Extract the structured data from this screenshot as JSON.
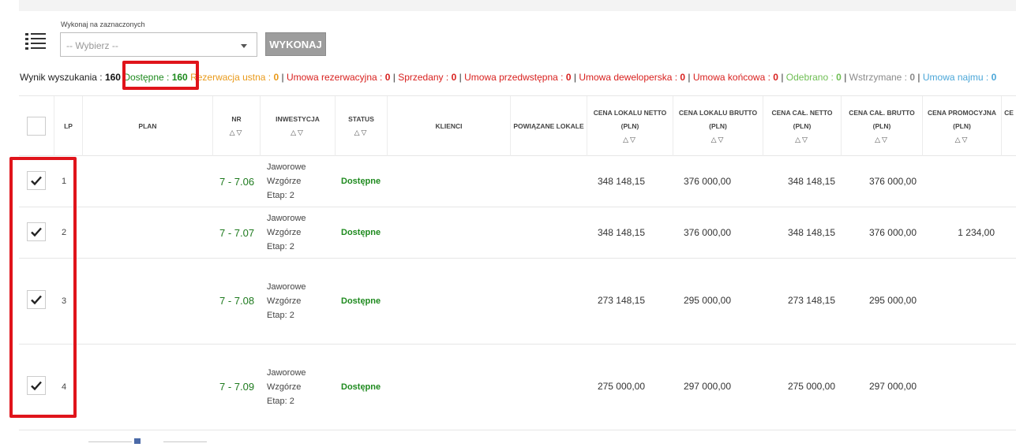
{
  "toolbar": {
    "action_label": "Wykonaj na zaznaczonych",
    "select_value": "-- Wybierz --",
    "execute_button": "WYKONAJ"
  },
  "summary": {
    "label": "Wynik wyszukania :",
    "total": "160",
    "statuses": [
      {
        "label": "Dostępne :",
        "count": "160",
        "color": "#1e8a1e"
      },
      {
        "label": "Rezerwacja ustna :",
        "count": "0",
        "color": "#e99a1a"
      },
      {
        "label": "Umowa rezerwacyjna :",
        "count": "0",
        "color": "#d8211f"
      },
      {
        "label": "Sprzedany :",
        "count": "0",
        "color": "#d8211f"
      },
      {
        "label": "Umowa przedwstępna :",
        "count": "0",
        "color": "#d8211f"
      },
      {
        "label": "Umowa deweloperska :",
        "count": "0",
        "color": "#d8211f"
      },
      {
        "label": "Umowa końcowa :",
        "count": "0",
        "color": "#d8211f"
      },
      {
        "label": "Odebrano :",
        "count": "0",
        "color": "#6fbe54"
      },
      {
        "label": "Wstrzymane :",
        "count": "0",
        "color": "#8a8a8a"
      },
      {
        "label": "Umowa najmu :",
        "count": "0",
        "color": "#4aa6d8"
      }
    ],
    "separator": "|"
  },
  "table": {
    "headers": {
      "lp": "LP",
      "plan": "PLAN",
      "nr": "NR",
      "inwestycja": "INWESTYCJA",
      "status": "STATUS",
      "klienci": "KLIENCI",
      "powiazane": "POWIĄZANE LOKALE",
      "netto": "CENA LOKALU NETTO",
      "brutto": "CENA LOKALU BRUTTO",
      "cal_netto": "CENA CAŁ. NETTO",
      "cal_brutto": "CENA CAŁ. BRUTTO",
      "promo": "CENA PROMOCYJNA",
      "cut": "CE",
      "currency": "(PLN)",
      "sort_glyph": "△▽"
    },
    "rows": [
      {
        "lp": "1",
        "nr": "7 - 7.06",
        "inv1": "Jaworowe",
        "inv2": "Wzgórze",
        "inv3": "Etap: 2",
        "status": "Dostępne",
        "netto": "348 148,15",
        "brutto": "376 000,00",
        "cal_netto": "348 148,15",
        "cal_brutto": "376 000,00",
        "promo": ""
      },
      {
        "lp": "2",
        "nr": "7 - 7.07",
        "inv1": "Jaworowe",
        "inv2": "Wzgórze",
        "inv3": "Etap: 2",
        "status": "Dostępne",
        "netto": "348 148,15",
        "brutto": "376 000,00",
        "cal_netto": "348 148,15",
        "cal_brutto": "376 000,00",
        "promo": "1 234,00"
      },
      {
        "lp": "3",
        "nr": "7 - 7.08",
        "inv1": "Jaworowe",
        "inv2": "Wzgórze",
        "inv3": "Etap: 2",
        "status": "Dostępne",
        "netto": "273 148,15",
        "brutto": "295 000,00",
        "cal_netto": "273 148,15",
        "cal_brutto": "295 000,00",
        "promo": ""
      },
      {
        "lp": "4",
        "nr": "7 - 7.09",
        "inv1": "Jaworowe",
        "inv2": "Wzgórze",
        "inv3": "Etap: 2",
        "status": "Dostępne",
        "netto": "275 000,00",
        "brutto": "297 000,00",
        "cal_netto": "275 000,00",
        "cal_brutto": "297 000,00",
        "promo": ""
      }
    ]
  },
  "highlight_color": "#e0141b",
  "icons": {
    "list": "list-icon",
    "check": "checkmark-icon",
    "dropdown": "chevron-down-icon"
  }
}
